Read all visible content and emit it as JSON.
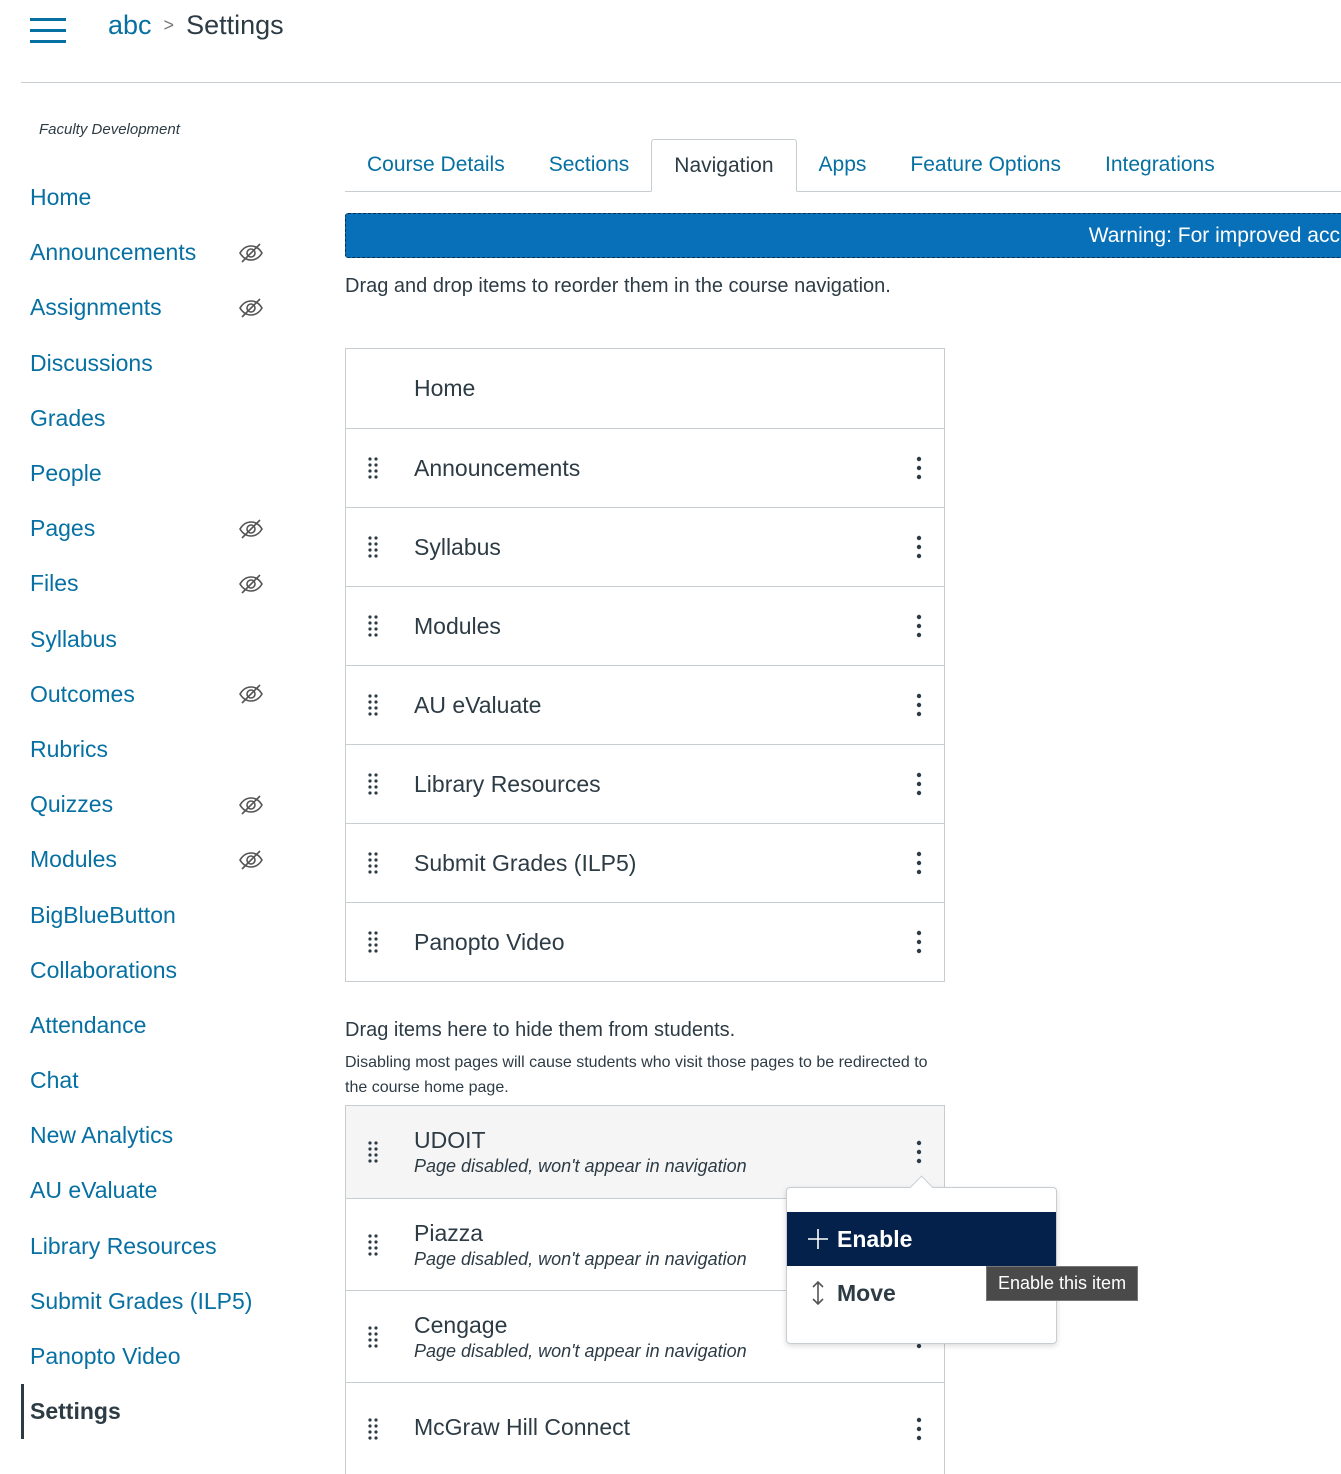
{
  "header": {
    "breadcrumb": [
      {
        "label": "abc"
      },
      {
        "label": "Settings"
      }
    ]
  },
  "sidebar": {
    "course_name": "Faculty Development",
    "items": [
      {
        "label": "Home",
        "hidden": false
      },
      {
        "label": "Announcements",
        "hidden": true
      },
      {
        "label": "Assignments",
        "hidden": true
      },
      {
        "label": "Discussions",
        "hidden": false
      },
      {
        "label": "Grades",
        "hidden": false
      },
      {
        "label": "People",
        "hidden": false
      },
      {
        "label": "Pages",
        "hidden": true
      },
      {
        "label": "Files",
        "hidden": true
      },
      {
        "label": "Syllabus",
        "hidden": false
      },
      {
        "label": "Outcomes",
        "hidden": true
      },
      {
        "label": "Rubrics",
        "hidden": false
      },
      {
        "label": "Quizzes",
        "hidden": true
      },
      {
        "label": "Modules",
        "hidden": true
      },
      {
        "label": "BigBlueButton",
        "hidden": false
      },
      {
        "label": "Collaborations",
        "hidden": false
      },
      {
        "label": "Attendance",
        "hidden": false
      },
      {
        "label": "Chat",
        "hidden": false
      },
      {
        "label": "New Analytics",
        "hidden": false
      },
      {
        "label": "AU eValuate",
        "hidden": false
      },
      {
        "label": "Library Resources",
        "hidden": false
      },
      {
        "label": "Submit Grades (ILP5)",
        "hidden": false
      },
      {
        "label": "Panopto Video",
        "hidden": false
      },
      {
        "label": "Settings",
        "hidden": false,
        "active": true
      }
    ]
  },
  "tabs": [
    {
      "label": "Course Details"
    },
    {
      "label": "Sections"
    },
    {
      "label": "Navigation",
      "active": true
    },
    {
      "label": "Apps"
    },
    {
      "label": "Feature Options"
    },
    {
      "label": "Integrations"
    }
  ],
  "warning": "Warning: For improved acc",
  "intro": "Drag and drop items to reorder them in the course navigation.",
  "enabled_items": [
    "Home",
    "Announcements",
    "Syllabus",
    "Modules",
    "AU eValuate",
    "Library Resources",
    "Submit Grades (ILP5)",
    "Panopto Video"
  ],
  "hidden_heading": "Drag items here to hide them from students.",
  "hidden_sub": "Disabling most pages will cause students who visit those pages to be redirected to the course home page.",
  "disabled_items": [
    {
      "label": "UDOIT",
      "status": "Page disabled, won't appear in navigation"
    },
    {
      "label": "Piazza",
      "status": "Page disabled, won't appear in navigation"
    },
    {
      "label": "Cengage",
      "status": "Page disabled, won't appear in navigation"
    },
    {
      "label": "McGraw Hill Connect",
      "status": ""
    }
  ],
  "menu": {
    "enable": "Enable",
    "move": "Move",
    "tooltip": "Enable this item"
  },
  "colors": {
    "link": "#0770a3",
    "banner": "#0770b8",
    "menu_selected": "#03214b"
  }
}
